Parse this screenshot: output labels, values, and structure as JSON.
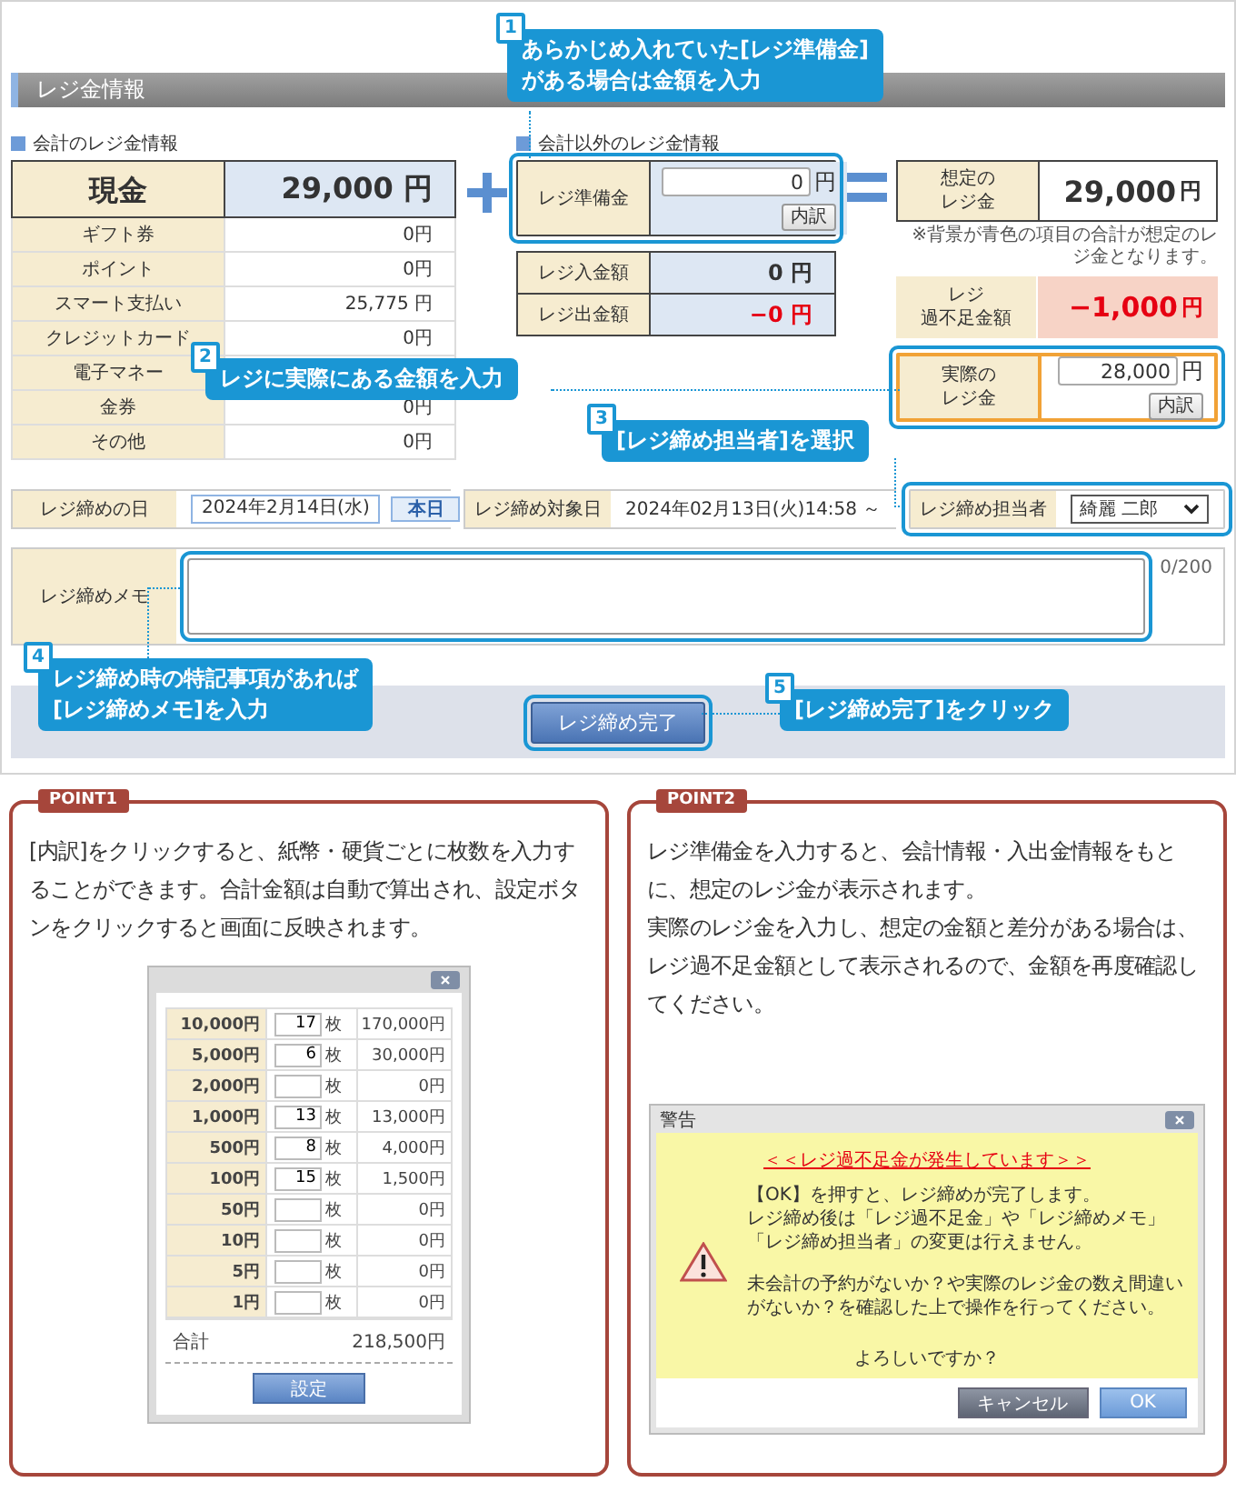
{
  "header": {
    "title": "レジ金情報"
  },
  "accounting": {
    "heading": "会計のレジ金情報",
    "cash": {
      "label": "現金",
      "value": "29,000 円"
    },
    "rows": [
      {
        "label": "ギフト券",
        "value": "0円"
      },
      {
        "label": "ポイント",
        "value": "0円"
      },
      {
        "label": "スマート支払い",
        "value": "25,775 円"
      },
      {
        "label": "クレジットカード",
        "value": "0円"
      },
      {
        "label": "電子マネー"
      },
      {
        "label": "金券",
        "value": "0円"
      },
      {
        "label": "その他",
        "value": "0円"
      }
    ]
  },
  "non_accounting": {
    "heading": "会計以外のレジ金情報",
    "reserve": {
      "label": "レジ準備金",
      "value": "0",
      "unit": "円",
      "button": "内訳"
    },
    "deposit": {
      "label": "レジ入金額",
      "value": "0 円",
      "negative": false
    },
    "withdrawal": {
      "label": "レジ出金額",
      "value": "−0 円",
      "negative": true
    }
  },
  "expected": {
    "label_lines": [
      "想定の",
      "レジ金"
    ],
    "value": "29,000",
    "unit": "円",
    "negative": false,
    "note": "※背景が青色の項目の合計が想定のレジ金となります。"
  },
  "difference": {
    "label_lines": [
      "レジ",
      "過不足金額"
    ],
    "value": "−1,000",
    "unit": "円",
    "negative": true
  },
  "actual": {
    "label_lines": [
      "実際の",
      "レジ金"
    ],
    "value": "28,000",
    "unit": "円",
    "button": "内訳"
  },
  "closing": {
    "date_label": "レジ締めの日",
    "date_value": "2024年2月14日(水)",
    "today_button": "本日",
    "target_label": "レジ締め対象日",
    "target_value": "2024年02月13日(火)14:58 ～",
    "staff_label": "レジ締め担当者",
    "staff_value": "綺麗 二郎"
  },
  "memo": {
    "label": "レジ締めメモ",
    "counter": "0/200"
  },
  "submit_button": "レジ締め完了",
  "callouts": [
    {
      "number": "1",
      "text": "あらかじめ入れていた[レジ準備金]\nがある場合は金額を入力"
    },
    {
      "number": "2",
      "text": "レジに実際にある金額を入力"
    },
    {
      "number": "3",
      "text": "[レジ締め担当者]を選択"
    },
    {
      "number": "4",
      "text": "レジ締め時の特記事項があれば\n[レジ締めメモ]を入力"
    },
    {
      "number": "5",
      "text": "[レジ締め完了]をクリック"
    }
  ],
  "points": [
    {
      "label": "POINT1",
      "paragraphs": [
        "[内訳]をクリックすると、紙幣・硬貨ごとに枚数を入力することができます。合計金額は自動で算出され、設定ボタンをクリックすると画面に反映されます。"
      ],
      "kind": "denomination_popup",
      "window": {
        "rows": [
          {
            "denomination": "10,000円",
            "count": "17",
            "unit": "枚",
            "amount": "170,000円"
          },
          {
            "denomination": "5,000円",
            "count": "6",
            "unit": "枚",
            "amount": "30,000円"
          },
          {
            "denomination": "2,000円",
            "unit": "枚",
            "amount": "0円"
          },
          {
            "denomination": "1,000円",
            "count": "13",
            "unit": "枚",
            "amount": "13,000円"
          },
          {
            "denomination": "500円",
            "count": "8",
            "unit": "枚",
            "amount": "4,000円"
          },
          {
            "denomination": "100円",
            "count": "15",
            "unit": "枚",
            "amount": "1,500円"
          },
          {
            "denomination": "50円",
            "unit": "枚",
            "amount": "0円"
          },
          {
            "denomination": "10円",
            "unit": "枚",
            "amount": "0円"
          },
          {
            "denomination": "5円",
            "unit": "枚",
            "amount": "0円"
          },
          {
            "denomination": "1円",
            "unit": "枚",
            "amount": "0円"
          }
        ],
        "total_label": "合計",
        "total": "218,500円",
        "button": "設定"
      }
    },
    {
      "label": "POINT2",
      "paragraphs": [
        "レジ準備金を入力すると、会計情報・入出金情報をもとに、想定のレジ金が表示されます。",
        "実際のレジ金を入力し、想定の金額と差分がある場合は、レジ過不足金額として表示されるので、金額を再度確認してください。"
      ],
      "kind": "warning_dialog",
      "window": {
        "title": "警告",
        "headline": "＜＜レジ過不足金が発生しています＞＞",
        "paragraphs": [
          [
            "【OK】を押すと、レジ締めが完了します。",
            "レジ締め後は「レジ過不足金」や「レジ締めメモ」「レジ締め担当者」の変更は行えません。"
          ],
          [
            "未会計の予約がないか？や実際のレジ金の数え間違いがないか？を確認した上で操作を行ってください。"
          ]
        ],
        "question": "よろしいですか？",
        "buttons": [
          "キャンセル",
          "OK"
        ]
      }
    }
  ]
}
